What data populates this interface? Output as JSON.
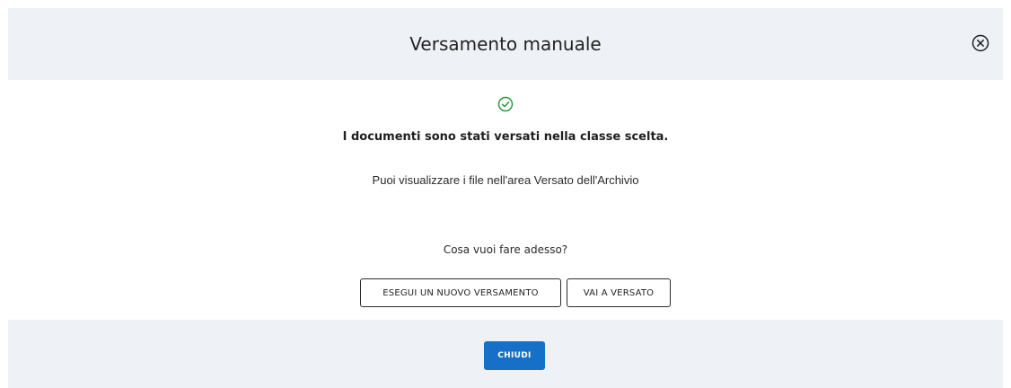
{
  "modal": {
    "title": "Versamento manuale",
    "close_icon": "close-circle-icon"
  },
  "body": {
    "status_icon": "check-circle-icon",
    "status_color": "#2e9a3f",
    "headline": "I documenti sono stati versati nella classe scelta.",
    "subtext": "Puoi visualizzare i file nell'area Versato dell'Archivio",
    "question": "Cosa vuoi fare adesso?",
    "actions": {
      "new_deposit_label": "ESEGUI UN NUOVO VERSAMENTO",
      "go_to_deposited_label": "VAI A VERSATO"
    }
  },
  "footer": {
    "close_label": "CHIUDI",
    "close_color": "#1670c7"
  }
}
